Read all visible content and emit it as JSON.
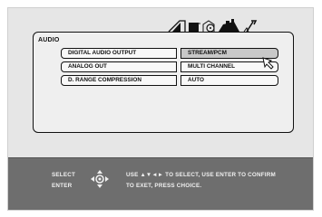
{
  "panel": {
    "title": "AUDIO"
  },
  "tabs": [
    {
      "icon": "audio-tab-icon"
    },
    {
      "icon": "picture-tab-icon"
    },
    {
      "icon": "disc-tab-icon"
    },
    {
      "icon": "speaker-tab-icon"
    },
    {
      "icon": "wrench-tab-icon"
    }
  ],
  "settings": [
    {
      "label": "DIGITAL AUDIO OUTPUT",
      "value": "STREAM/PCM",
      "selected": true
    },
    {
      "label": "ANALOG OUT",
      "value": "MULTI CHANNEL",
      "selected": false
    },
    {
      "label": "D. RANGE COMPRESSION",
      "value": "AUTO",
      "selected": false
    }
  ],
  "footer": {
    "select_label": "SELECT",
    "enter_label": "ENTER",
    "help_line1": "USE ▲▼◄► TO SELECT, USE ENTER TO CONFIRM",
    "help_line2": "TO EXET, PRESS CHOICE."
  },
  "colors": {
    "screen_bg": "#e6e6e6",
    "footer_bg": "#6e6e6e",
    "selected_bg": "#c8c8c8"
  }
}
